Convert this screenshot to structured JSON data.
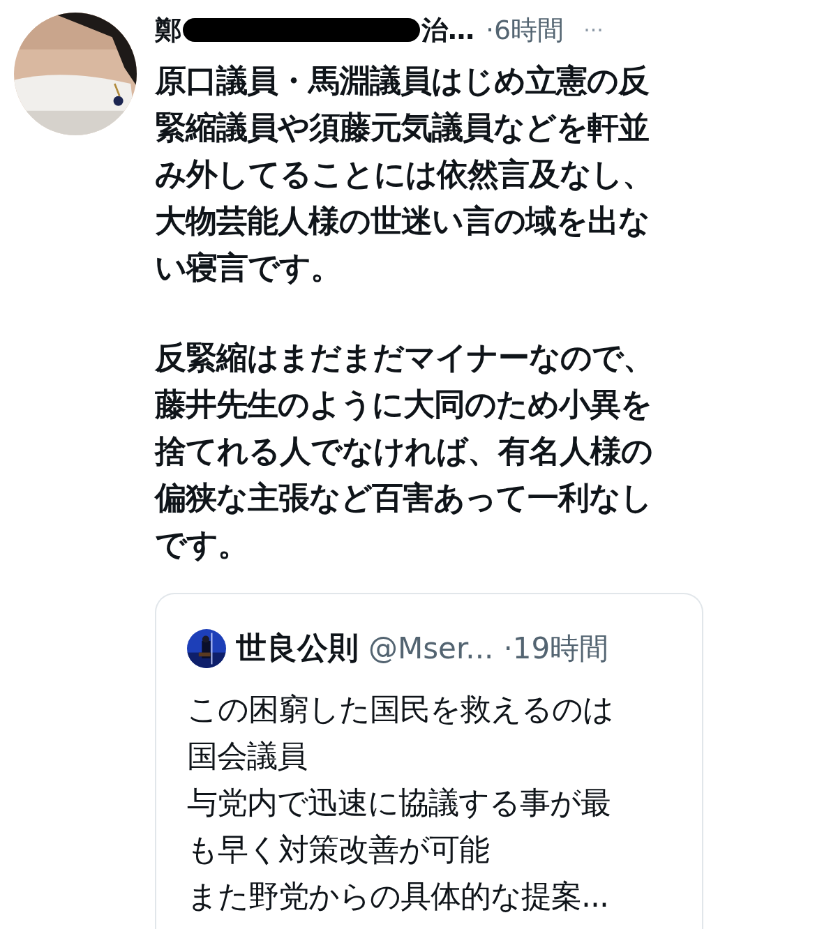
{
  "tweet": {
    "name_start": "鄭",
    "name_redacted": true,
    "name_end": "治…",
    "time": "·6時間",
    "more": "···",
    "paragraphs": [
      [
        "原口議員・馬淵議員はじめ立憲の反",
        "緊縮議員や須藤元気議員などを軒並",
        "み外してることには依然言及なし、",
        "大物芸能人様の世迷い言の域を出な",
        "い寝言です。"
      ],
      [
        "反緊縮はまだまだマイナーなので、",
        "藤井先生のように大同のため小異を",
        "捨てれる人でなければ、有名人様の",
        "偏狭な主張など百害あって一利なし",
        "です。"
      ]
    ],
    "quote": {
      "name": "世良公則",
      "handle": "@Mser...",
      "time": "·19時間",
      "lines": [
        "この困窮した国民を救えるのは",
        "国会議員",
        "与党内で迅速に協議する事が最",
        "も早く対策改善が可能",
        "また野党からの具体的な提案..."
      ]
    }
  }
}
